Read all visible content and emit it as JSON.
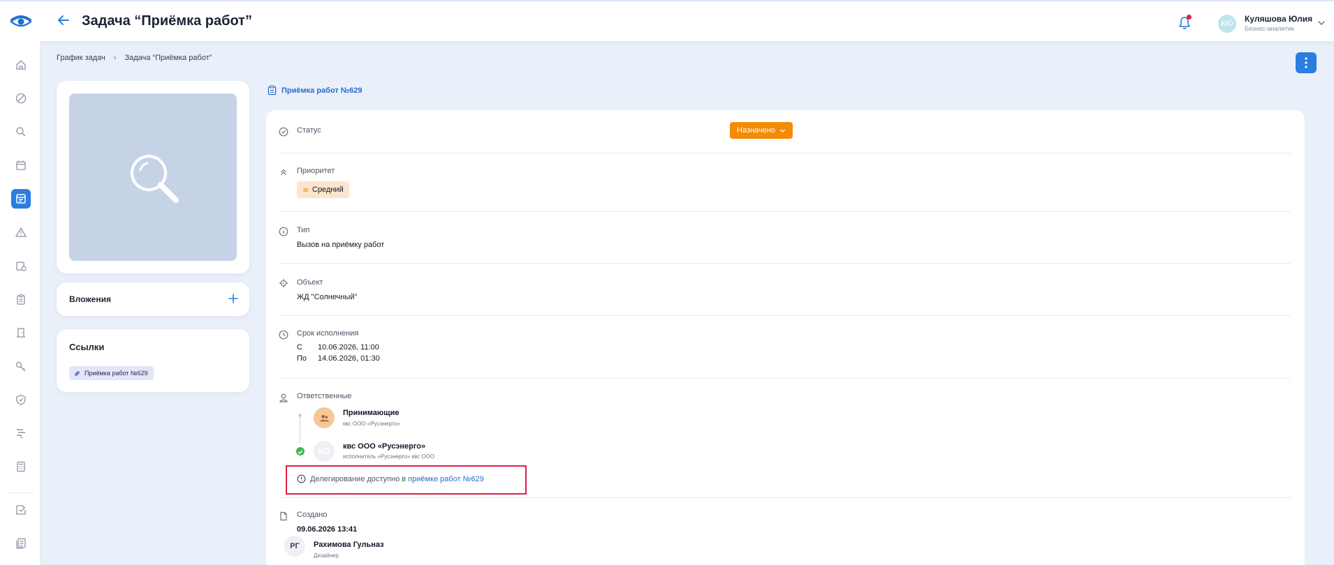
{
  "header": {
    "title": "Задача “Приёмка работ”",
    "user": {
      "initials": "КЮ",
      "name": "Куляшова Юлия",
      "role": "Бизнес-аналитик"
    }
  },
  "breadcrumb": {
    "items": [
      "График задач",
      "Задача “Приёмка работ”"
    ],
    "separator": "›"
  },
  "sidebar": {
    "icons": [
      "home-icon",
      "ban-icon",
      "search-icon",
      "calendar-icon",
      "tasks-board-icon",
      "warning-icon",
      "calendar-check-icon",
      "clipboard-icon",
      "door-icon",
      "key-icon",
      "shield-check-icon",
      "hierarchy-icon",
      "calculator-icon",
      "checklist-icon",
      "documents-icon"
    ],
    "active": "tasks-board-icon"
  },
  "left": {
    "attachments_label": "Вложения",
    "links_label": "Ссылки",
    "link_chip": "Приёмка работ №629"
  },
  "task_link": "Приёмка работ №629",
  "fields": {
    "status": {
      "label": "Статус",
      "value": "Назначено"
    },
    "priority": {
      "label": "Приоритет",
      "value": "Средний"
    },
    "type": {
      "label": "Тип",
      "value": "Вызов на приёмку работ"
    },
    "object": {
      "label": "Объект",
      "value": "ЖД \"Солнечный\""
    },
    "deadline": {
      "label": "Срок исполнения",
      "from_label": "С",
      "from": "10.06.2026, 11:00",
      "to_label": "По",
      "to": "14.06.2026, 01:30"
    },
    "responsible": {
      "label": "Ответственные",
      "people": [
        {
          "name": "Принимающие",
          "sub": "квс ООО «Русэнерго»"
        },
        {
          "initials": "КО",
          "name": "квс ООО «Русэнерго»",
          "sub": "исполнитель «Русэнерго» квс ООО"
        }
      ],
      "delegation_text": "Делегирование доступно в ",
      "delegation_link": "приёмке работ №629"
    },
    "created": {
      "label": "Создано",
      "date": "09.06.2026 13:41",
      "author_initials": "РГ",
      "author_name": "Рахимова Гульназ",
      "author_role": "Дизайнер"
    }
  },
  "colors": {
    "accent": "#2b7de0",
    "status": "#f58a07",
    "priority_bg": "#fde4cd",
    "highlight_border": "#e11d48"
  }
}
